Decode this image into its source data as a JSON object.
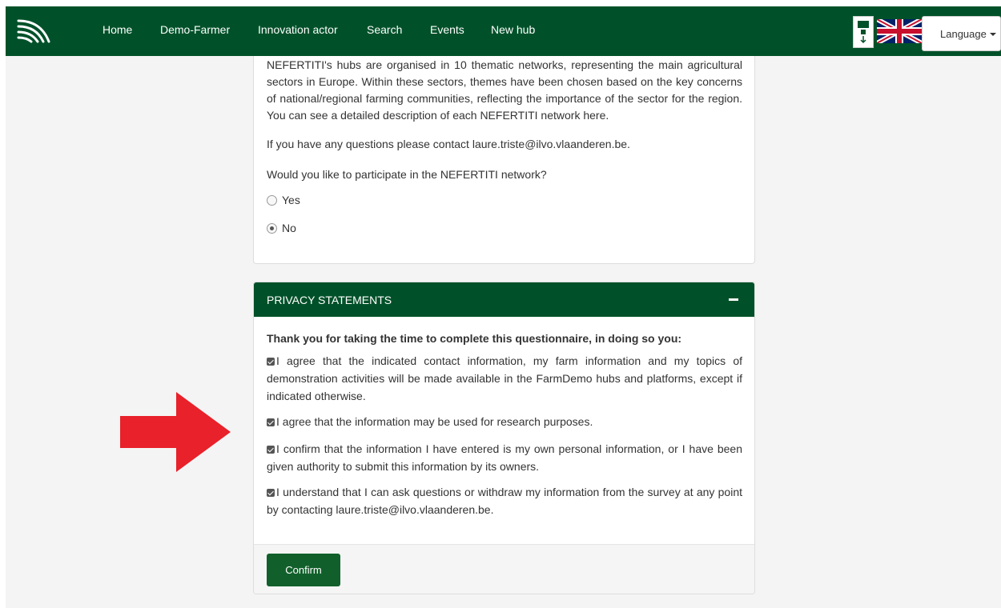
{
  "nav": {
    "items": [
      "Home",
      "Demo-Farmer",
      "Innovation actor",
      "Search",
      "Events",
      "New hub"
    ],
    "language_label": "Language"
  },
  "network": {
    "intro": "NEFERTITI's hubs are organised in 10 thematic networks, representing the main agricultural sectors in Europe. Within these sectors, themes have been chosen based on the key concerns of national/regional farming communities, reflecting the importance of the sector for the region. You can see a detailed description of each NEFERTITI network here.",
    "contact": "If you have any questions please contact laure.triste@ilvo.vlaanderen.be.",
    "question": "Would you like to participate in the NEFERTITI network?",
    "options": [
      {
        "label": "Yes",
        "selected": false
      },
      {
        "label": "No",
        "selected": true
      }
    ]
  },
  "privacy": {
    "title": "PRIVACY STATEMENTS",
    "thanks": "Thank you for taking the time to complete this questionnaire, in doing so you:",
    "statements": [
      {
        "text": "I agree that the indicated contact information, my farm information and my topics of demonstration activities will be made available in the FarmDemo hubs and platforms, except if indicated otherwise.",
        "checked": true
      },
      {
        "text": "I agree that the information may be used for research purposes.",
        "checked": true
      },
      {
        "text": "I confirm that the information I have entered is my own personal information, or I have been given authority to submit this information by its owners.",
        "checked": true
      },
      {
        "text": "I understand that I can ask questions or withdraw my information from the survey at any point by contacting laure.triste@ilvo.vlaanderen.be.",
        "checked": true
      }
    ],
    "confirm_label": "Confirm"
  },
  "colors": {
    "brand_green": "#005129",
    "button_green": "#11602b",
    "arrow_red": "#e8212a"
  }
}
